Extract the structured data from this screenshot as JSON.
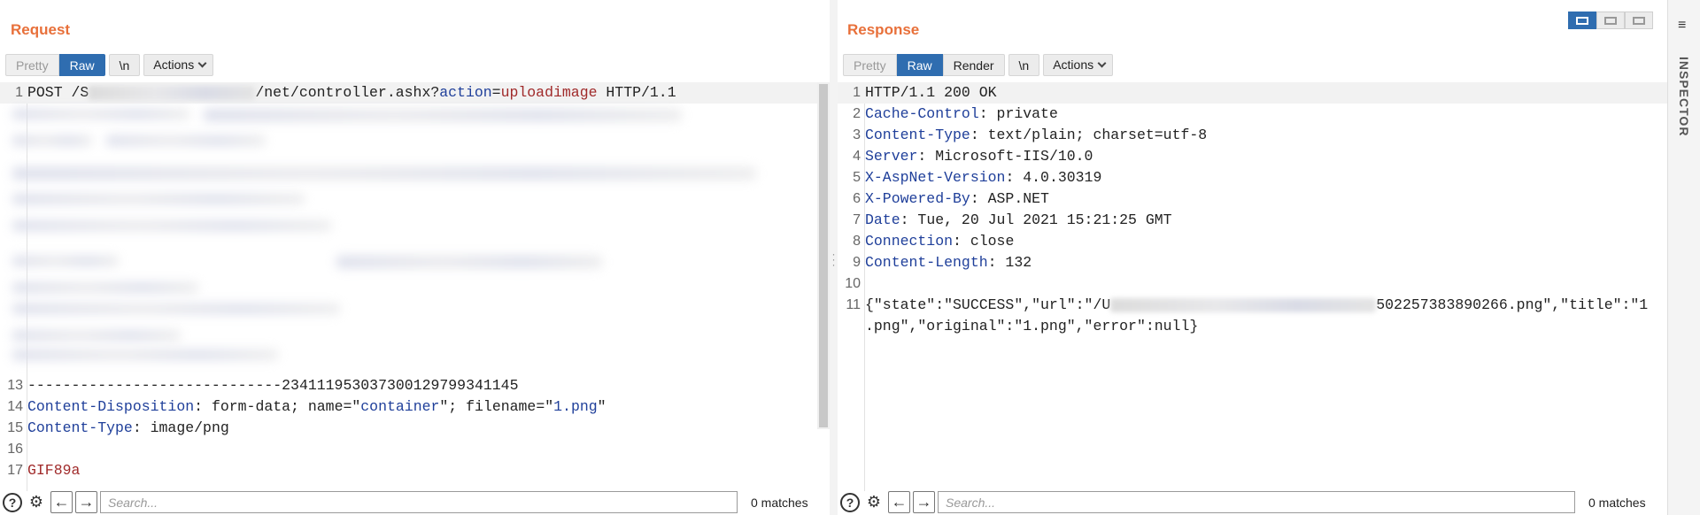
{
  "request": {
    "title": "Request",
    "tabs": [
      "Pretty",
      "Raw",
      "\\n"
    ],
    "actions_label": "Actions",
    "lines": {
      "l1_num": "1",
      "l1_method": "POST /S",
      "l1_path": "/net/controller.ashx?",
      "l1_key": "action",
      "l1_eq": "=",
      "l1_val": "uploadimage",
      "l1_proto": " HTTP/1.1",
      "l13_num": "13",
      "l13_text": "-----------------------------234111953037300129799341145",
      "l14_num": "14",
      "l14_key": "Content-Disposition",
      "l14_a": ": form-data; name=\"",
      "l14_name": "container",
      "l14_b": "\"; filename=\"",
      "l14_file": "1.png",
      "l14_c": "\"",
      "l15_num": "15",
      "l15_key": "Content-Type",
      "l15_val": ": image/png",
      "l16_num": "16",
      "l17_num": "17",
      "l17_text": "GIF89a"
    },
    "search_placeholder": "Search...",
    "matches": "0 matches"
  },
  "response": {
    "title": "Response",
    "tabs": [
      "Pretty",
      "Raw",
      "Render",
      "\\n"
    ],
    "actions_label": "Actions",
    "lines": {
      "n1": "1",
      "t1": "HTTP/1.1 200 OK",
      "n2": "2",
      "k2": "Cache-Control",
      "v2": ": private",
      "n3": "3",
      "k3": "Content-Type",
      "v3": ": text/plain; charset=utf-8",
      "n4": "4",
      "k4": "Server",
      "v4": ": Microsoft-IIS/10.0",
      "n5": "5",
      "k5": "X-AspNet-Version",
      "v5": ": 4.0.30319",
      "n6": "6",
      "k6": "X-Powered-By",
      "v6": ": ASP.NET",
      "n7": "7",
      "k7": "Date",
      "v7": ": Tue, 20 Jul 2021 15:21:25 GMT",
      "n8": "8",
      "k8": "Connection",
      "v8": ": close",
      "n9": "9",
      "k9": "Content-Length",
      "v9": ": 132",
      "n10": "10",
      "n11": "11",
      "t11a": "{\"state\":\"SUCCESS\",\"url\":\"/U",
      "t11b": "502257383890266.png\",\"title\":\"1",
      "t11c": ".png\",\"original\":\"1.png\",\"error\":null}"
    },
    "search_placeholder": "Search...",
    "matches": "0 matches"
  },
  "inspector": {
    "label": "INSPECTOR"
  },
  "colors": {
    "accent": "#e8703a",
    "active_tab": "#2f6db0",
    "header_key": "#1f3f9a",
    "string_value": "#a02a2a"
  },
  "icons": [
    "help-icon",
    "settings-gear-icon",
    "arrow-left-icon",
    "arrow-right-icon",
    "menu-icon"
  ]
}
